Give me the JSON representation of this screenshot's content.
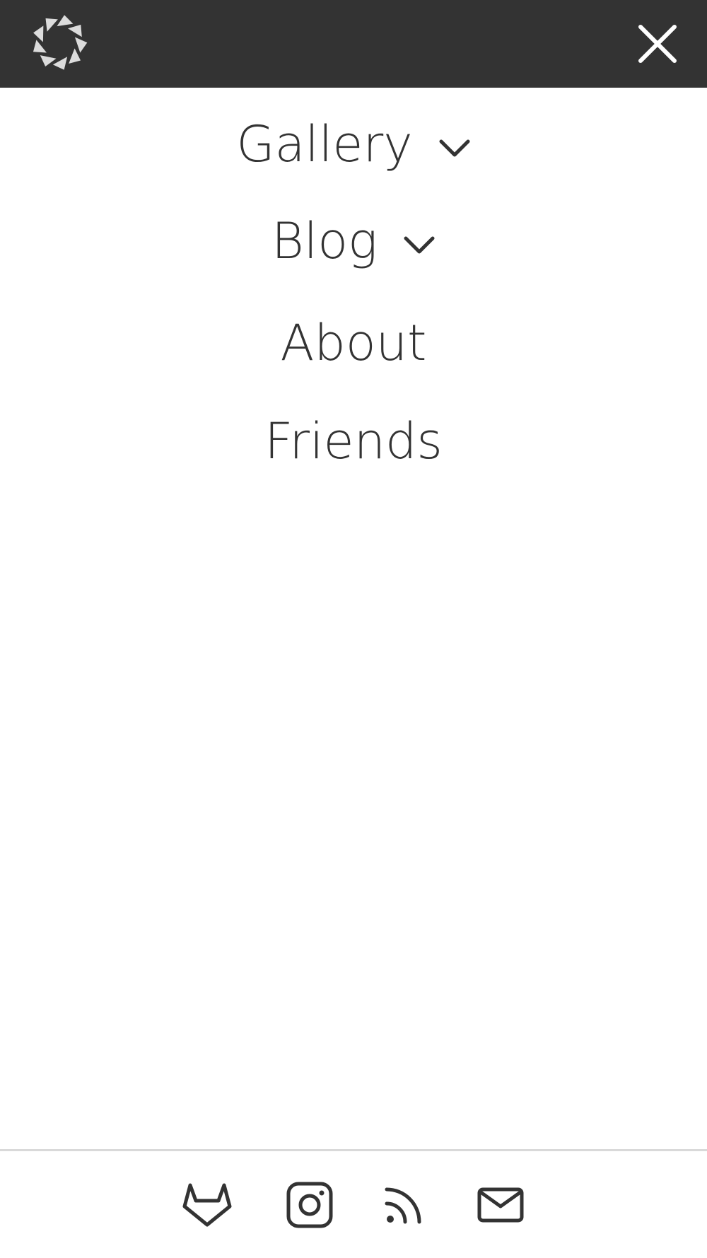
{
  "header": {
    "logo_icon": "aperture-logo-icon",
    "close_icon": "close-icon",
    "background": "#333333"
  },
  "nav": {
    "items": [
      {
        "label": "Gallery",
        "has_submenu": true,
        "icon": "chevron-down-icon"
      },
      {
        "label": "Blog",
        "has_submenu": true,
        "icon": "chevron-down-icon"
      },
      {
        "label": "About",
        "has_submenu": false
      },
      {
        "label": "Friends",
        "has_submenu": false
      }
    ]
  },
  "footer": {
    "social_icons": [
      "gitlab-icon",
      "instagram-icon",
      "rss-icon",
      "mail-icon"
    ]
  },
  "colors": {
    "text": "#333333",
    "divider": "#d9d9d9",
    "logo": "#dcdcdc"
  }
}
